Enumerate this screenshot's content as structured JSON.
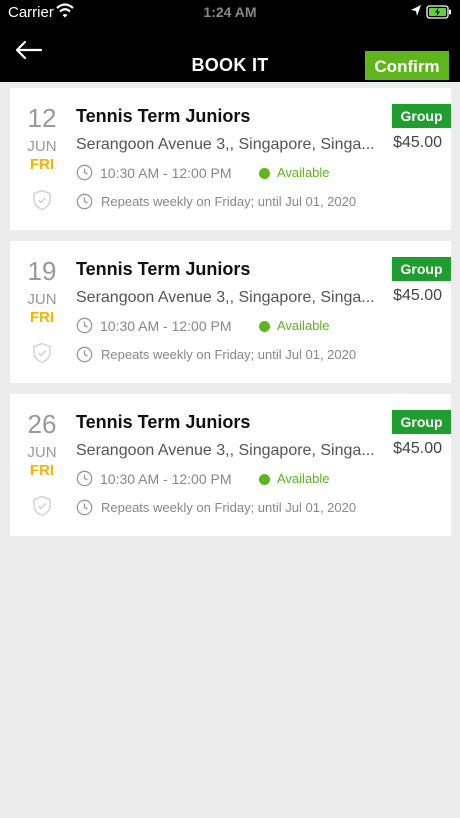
{
  "status_bar": {
    "carrier": "Carrier",
    "time": "1:24 AM",
    "icons": [
      "wifi-icon",
      "location-arrow-icon",
      "battery-charging-icon"
    ]
  },
  "nav": {
    "back_icon": "arrow-left-icon",
    "title": "BOOK IT",
    "confirm_label": "Confirm"
  },
  "colors": {
    "nav_bg": "#000000",
    "confirm_bg": "#5fb51c",
    "badge_bg": "#1f9d2e",
    "available": "#5fb51c",
    "weekday": "#f1b400",
    "page_bg": "#ececec"
  },
  "sessions": [
    {
      "day": "12",
      "month": "JUN",
      "weekday": "FRI",
      "title": "Tennis Term Juniors",
      "address": "Serangoon Avenue 3,, Singapore, Singa...",
      "time": "10:30 AM - 12:00 PM",
      "status": "Available",
      "repeat": "Repeats weekly on Friday; until Jul 01, 2020",
      "badge": "Group",
      "price": "$45.00"
    },
    {
      "day": "19",
      "month": "JUN",
      "weekday": "FRI",
      "title": "Tennis Term Juniors",
      "address": "Serangoon Avenue 3,, Singapore, Singa...",
      "time": "10:30 AM - 12:00 PM",
      "status": "Available",
      "repeat": "Repeats weekly on Friday; until Jul 01, 2020",
      "badge": "Group",
      "price": "$45.00"
    },
    {
      "day": "26",
      "month": "JUN",
      "weekday": "FRI",
      "title": "Tennis Term Juniors",
      "address": "Serangoon Avenue 3,, Singapore, Singa...",
      "time": "10:30 AM - 12:00 PM",
      "status": "Available",
      "repeat": "Repeats weekly on Friday; until Jul 01, 2020",
      "badge": "Group",
      "price": "$45.00"
    }
  ]
}
